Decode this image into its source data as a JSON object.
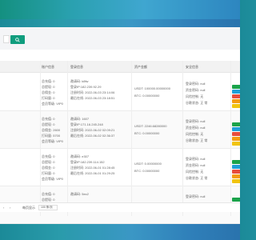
{
  "colors": {
    "accent": "#0f9d7e",
    "action_green": "#1aa34a",
    "action_blue": "#1e9fd8",
    "action_orange": "#f39c12",
    "action_red": "#e74c3c",
    "action_yellow": "#f1c40f"
  },
  "search": {
    "button_icon": "search-icon"
  },
  "table": {
    "headers": [
      "账户信息",
      "登录信息",
      "资产金额",
      "安全信息"
    ],
    "rows": [
      {
        "stats": [
          "总充值: 0",
          "总提现: 0",
          "总佣金: 0",
          "打码量: 0",
          "会员等级: VIP0"
        ],
        "login": [
          "邀请码: k8fw",
          "登录IP:182.239.92.29",
          "注册时间: 2022-06-03 23:14:06",
          "最后在线: 2022-06-03 23:18:51"
        ],
        "asset": [
          "USDT: 100000.00000000",
          "BTC: 0.00000000"
        ],
        "security": [
          "登录密码: null",
          "资金密码: null",
          "风险控制: 无",
          "谷歌状态: 正 常"
        ],
        "actions": [
          "green",
          "blue",
          "red",
          "orange",
          "yellow"
        ]
      },
      {
        "stats": [
          "总充值: 0",
          "总提现: 0",
          "总佣金: 2600",
          "打码量: 5700",
          "会员等级: VIP0"
        ],
        "login": [
          "邀请码: 1607",
          "登录IP:171.16.245.248",
          "注册时间: 2022-06-02 02:09:21",
          "最后在线: 2022-06-02 02:36:37"
        ],
        "asset": [
          "USDT: 2246.68280000",
          "BTC: 0.00000000"
        ],
        "security": [
          "登录密码: null",
          "资金密码: null",
          "风险控制: 无",
          "谷歌状态: 正 常"
        ],
        "actions": [
          "green",
          "blue",
          "red",
          "orange",
          "yellow"
        ]
      },
      {
        "stats": [
          "总充值: 0",
          "总提现: 0",
          "总佣金: 0",
          "打码量: 0",
          "会员等级: VIP0"
        ],
        "login": [
          "邀请码: e307",
          "登录IP:182.239.114.152",
          "注册时间: 2022-06-01 01:28:45",
          "最后在线: 2022-06-01 01:29:25"
        ],
        "asset": [
          "USDT: 0.00000000",
          "BTC: 0.00000000"
        ],
        "security": [
          "登录密码: null",
          "资金密码: null",
          "风险控制: 无",
          "谷歌状态: 正 常"
        ],
        "actions": [
          "green",
          "blue",
          "red",
          "orange",
          "yellow"
        ]
      },
      {
        "stats": [
          "总充值: 0",
          "总提现: 0"
        ],
        "login": [
          "邀请码: 5ec2"
        ],
        "asset": [],
        "security": [
          "登录密码: null"
        ],
        "actions": [
          "green",
          "blue"
        ]
      }
    ]
  },
  "footer": {
    "page_size_label": "每页显示",
    "page_size_value": "100 条/页",
    "prev": "‹",
    "next": "›"
  }
}
